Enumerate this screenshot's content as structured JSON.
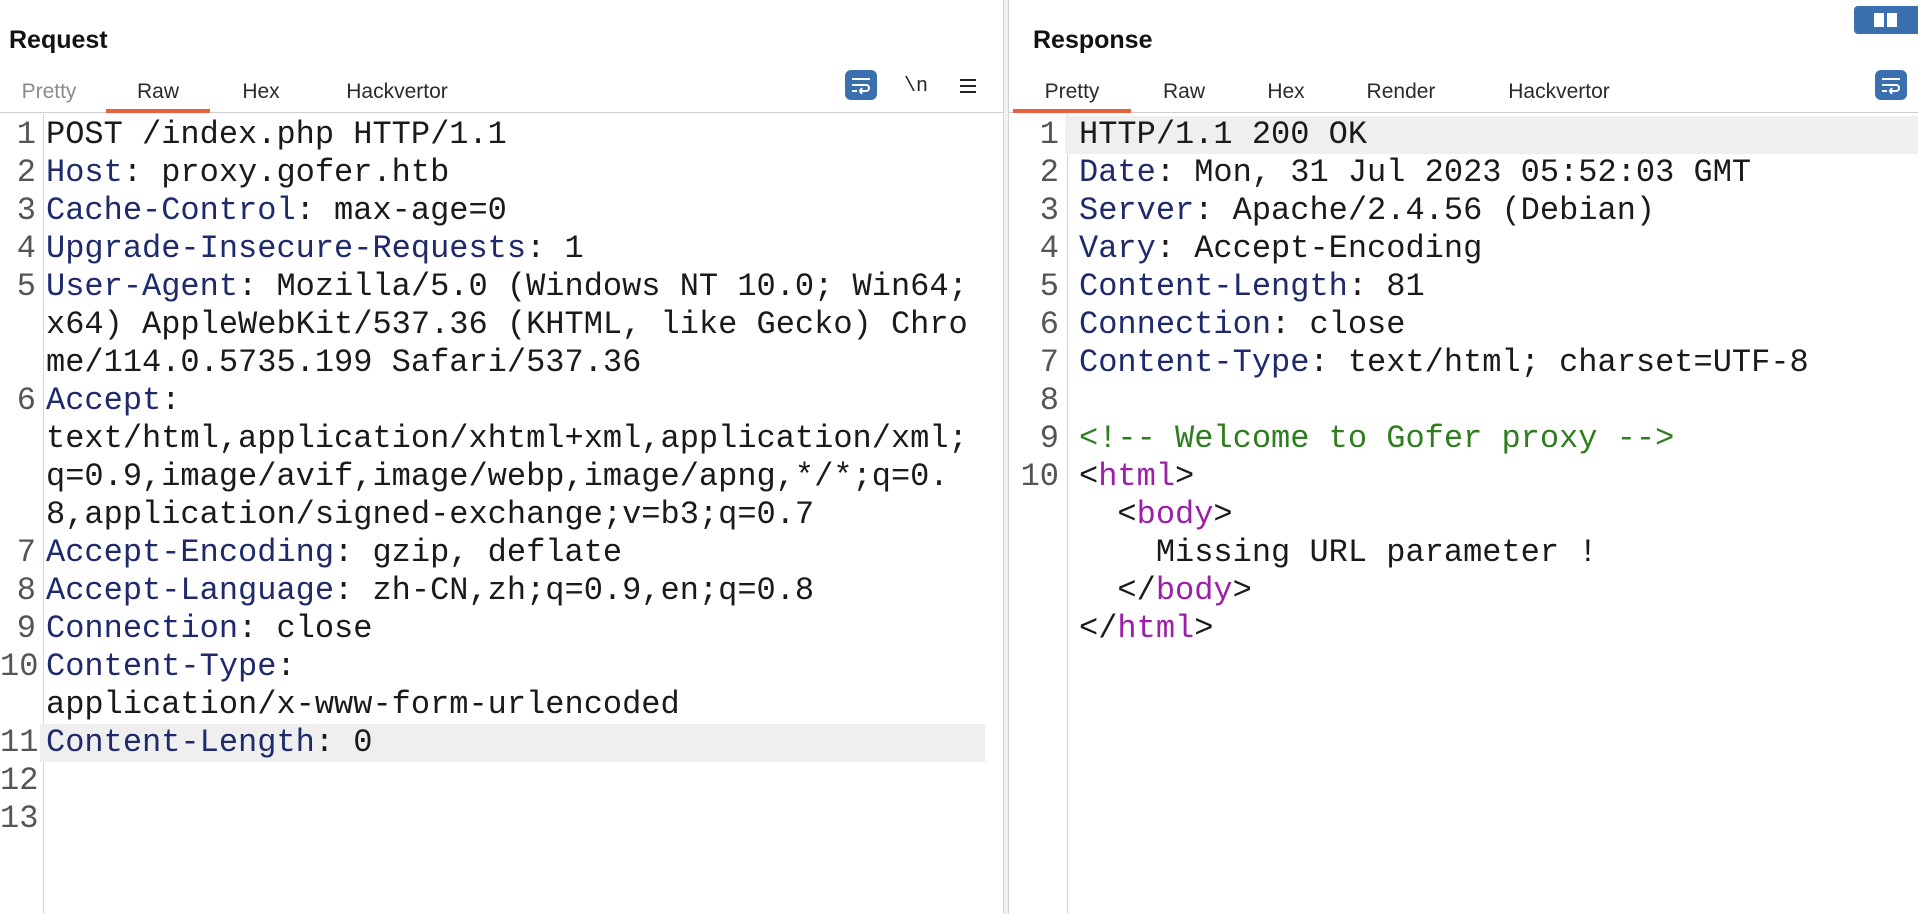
{
  "request": {
    "title": "Request",
    "tabs": [
      {
        "label": "Pretty",
        "state": "dim"
      },
      {
        "label": "Raw",
        "state": "active"
      },
      {
        "label": "Hex",
        "state": "normal"
      },
      {
        "label": "Hackvertor",
        "state": "normal"
      }
    ],
    "tools": {
      "wrap_icon": "wrap-lines-icon",
      "newline_label": "\\n",
      "menu_icon": "hamburger-menu-icon"
    },
    "lines": [
      {
        "n": "1",
        "key": "",
        "val": "POST /index.php HTTP/1.1"
      },
      {
        "n": "2",
        "key": "Host",
        "val": "proxy.gofer.htb"
      },
      {
        "n": "3",
        "key": "Cache-Control",
        "val": "max-age=0"
      },
      {
        "n": "4",
        "key": "Upgrade-Insecure-Requests",
        "val": "1"
      },
      {
        "n": "5",
        "key": "User-Agent",
        "val": "Mozilla/5.0 (Windows NT 10.0; Win64; x64) AppleWebKit/537.36 (KHTML, like Gecko) Chrome/114.0.5735.199 Safari/537.36"
      },
      {
        "n": "6",
        "key": "Accept",
        "val": "text/html,application/xhtml+xml,application/xml;q=0.9,image/avif,image/webp,image/apng,*/*;q=0.8,application/signed-exchange;v=b3;q=0.7"
      },
      {
        "n": "7",
        "key": "Accept-Encoding",
        "val": "gzip, deflate"
      },
      {
        "n": "8",
        "key": "Accept-Language",
        "val": "zh-CN,zh;q=0.9,en;q=0.8"
      },
      {
        "n": "9",
        "key": "Connection",
        "val": "close"
      },
      {
        "n": "10",
        "key": "Content-Type",
        "val": "application/x-www-form-urlencoded"
      },
      {
        "n": "11",
        "key": "Content-Length",
        "val": "0"
      },
      {
        "n": "12",
        "key": "",
        "val": ""
      },
      {
        "n": "13",
        "key": "",
        "val": ""
      }
    ]
  },
  "response": {
    "title": "Response",
    "tabs": [
      {
        "label": "Pretty",
        "state": "active"
      },
      {
        "label": "Raw",
        "state": "normal"
      },
      {
        "label": "Hex",
        "state": "normal"
      },
      {
        "label": "Render",
        "state": "normal"
      },
      {
        "label": "Hackvertor",
        "state": "normal"
      }
    ],
    "lines": [
      {
        "n": "1",
        "parts": [
          {
            "t": "HTTP/1.1 200 OK",
            "c": "plain"
          }
        ]
      },
      {
        "n": "2",
        "parts": [
          {
            "t": "Date",
            "c": "hk"
          },
          {
            "t": ": Mon, 31 Jul 2023 05:52:03 GMT",
            "c": "plain"
          }
        ]
      },
      {
        "n": "3",
        "parts": [
          {
            "t": "Server",
            "c": "hk"
          },
          {
            "t": ": Apache/2.4.56 (Debian)",
            "c": "plain"
          }
        ]
      },
      {
        "n": "4",
        "parts": [
          {
            "t": "Vary",
            "c": "hk"
          },
          {
            "t": ": Accept-Encoding",
            "c": "plain"
          }
        ]
      },
      {
        "n": "5",
        "parts": [
          {
            "t": "Content-Length",
            "c": "hk"
          },
          {
            "t": ": 81",
            "c": "plain"
          }
        ]
      },
      {
        "n": "6",
        "parts": [
          {
            "t": "Connection",
            "c": "hk"
          },
          {
            "t": ": close",
            "c": "plain"
          }
        ]
      },
      {
        "n": "7",
        "parts": [
          {
            "t": "Content-Type",
            "c": "hk"
          },
          {
            "t": ": text/html; charset=UTF-8",
            "c": "plain"
          }
        ]
      },
      {
        "n": "8",
        "parts": []
      },
      {
        "n": "9",
        "parts": [
          {
            "t": "<!-- Welcome to Gofer proxy -->",
            "c": "cm"
          }
        ]
      },
      {
        "n": "10",
        "parts": [
          {
            "t": "<",
            "c": "plain"
          },
          {
            "t": "html",
            "c": "tg"
          },
          {
            "t": ">",
            "c": "plain"
          }
        ]
      },
      {
        "n": "",
        "parts": [
          {
            "t": "  <",
            "c": "plain"
          },
          {
            "t": "body",
            "c": "tg"
          },
          {
            "t": ">",
            "c": "plain"
          }
        ]
      },
      {
        "n": "",
        "parts": [
          {
            "t": "    Missing URL parameter !",
            "c": "plain"
          }
        ]
      },
      {
        "n": "",
        "parts": [
          {
            "t": "  </",
            "c": "plain"
          },
          {
            "t": "body",
            "c": "tg"
          },
          {
            "t": ">",
            "c": "plain"
          }
        ]
      },
      {
        "n": "",
        "parts": [
          {
            "t": "</",
            "c": "plain"
          },
          {
            "t": "html",
            "c": "tg"
          },
          {
            "t": ">",
            "c": "plain"
          }
        ]
      }
    ]
  },
  "colors": {
    "accent_tab": "#e8603c",
    "button_blue": "#3a6fb0",
    "header_key": "#1e2a6b",
    "comment": "#2e7d1f",
    "tag": "#9b1fa8"
  },
  "highlight": {
    "request_line": "11",
    "response_line": "1"
  }
}
